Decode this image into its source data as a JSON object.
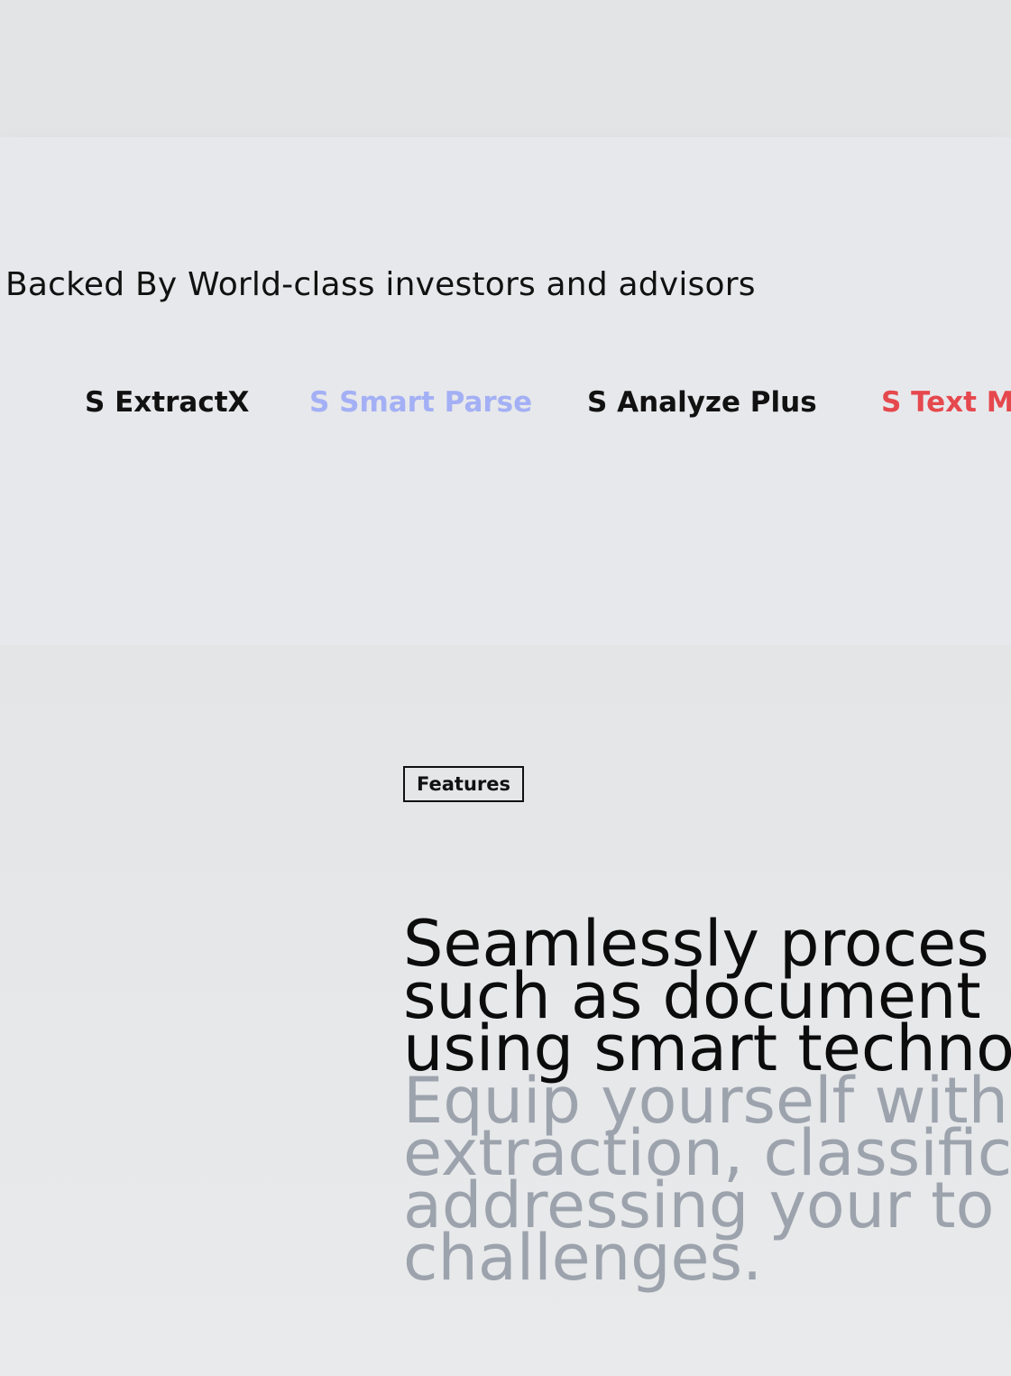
{
  "investors": {
    "heading": "Backed By World-class investors and advisors",
    "logos": [
      {
        "label": "S ExtractX",
        "color": "#111111"
      },
      {
        "label": "S Smart Parse",
        "color": "#a4b0f5"
      },
      {
        "label": "S Analyze Plus",
        "color": "#111111"
      },
      {
        "label": "S Text Mi",
        "color": "#e5484d"
      }
    ]
  },
  "features": {
    "badge": "Features",
    "headline_lines": [
      "Seamlessly proces",
      "such as document",
      "using smart techno"
    ],
    "subtext_lines": [
      "Equip yourself with",
      "extraction, classific",
      "addressing your to",
      "challenges."
    ]
  }
}
